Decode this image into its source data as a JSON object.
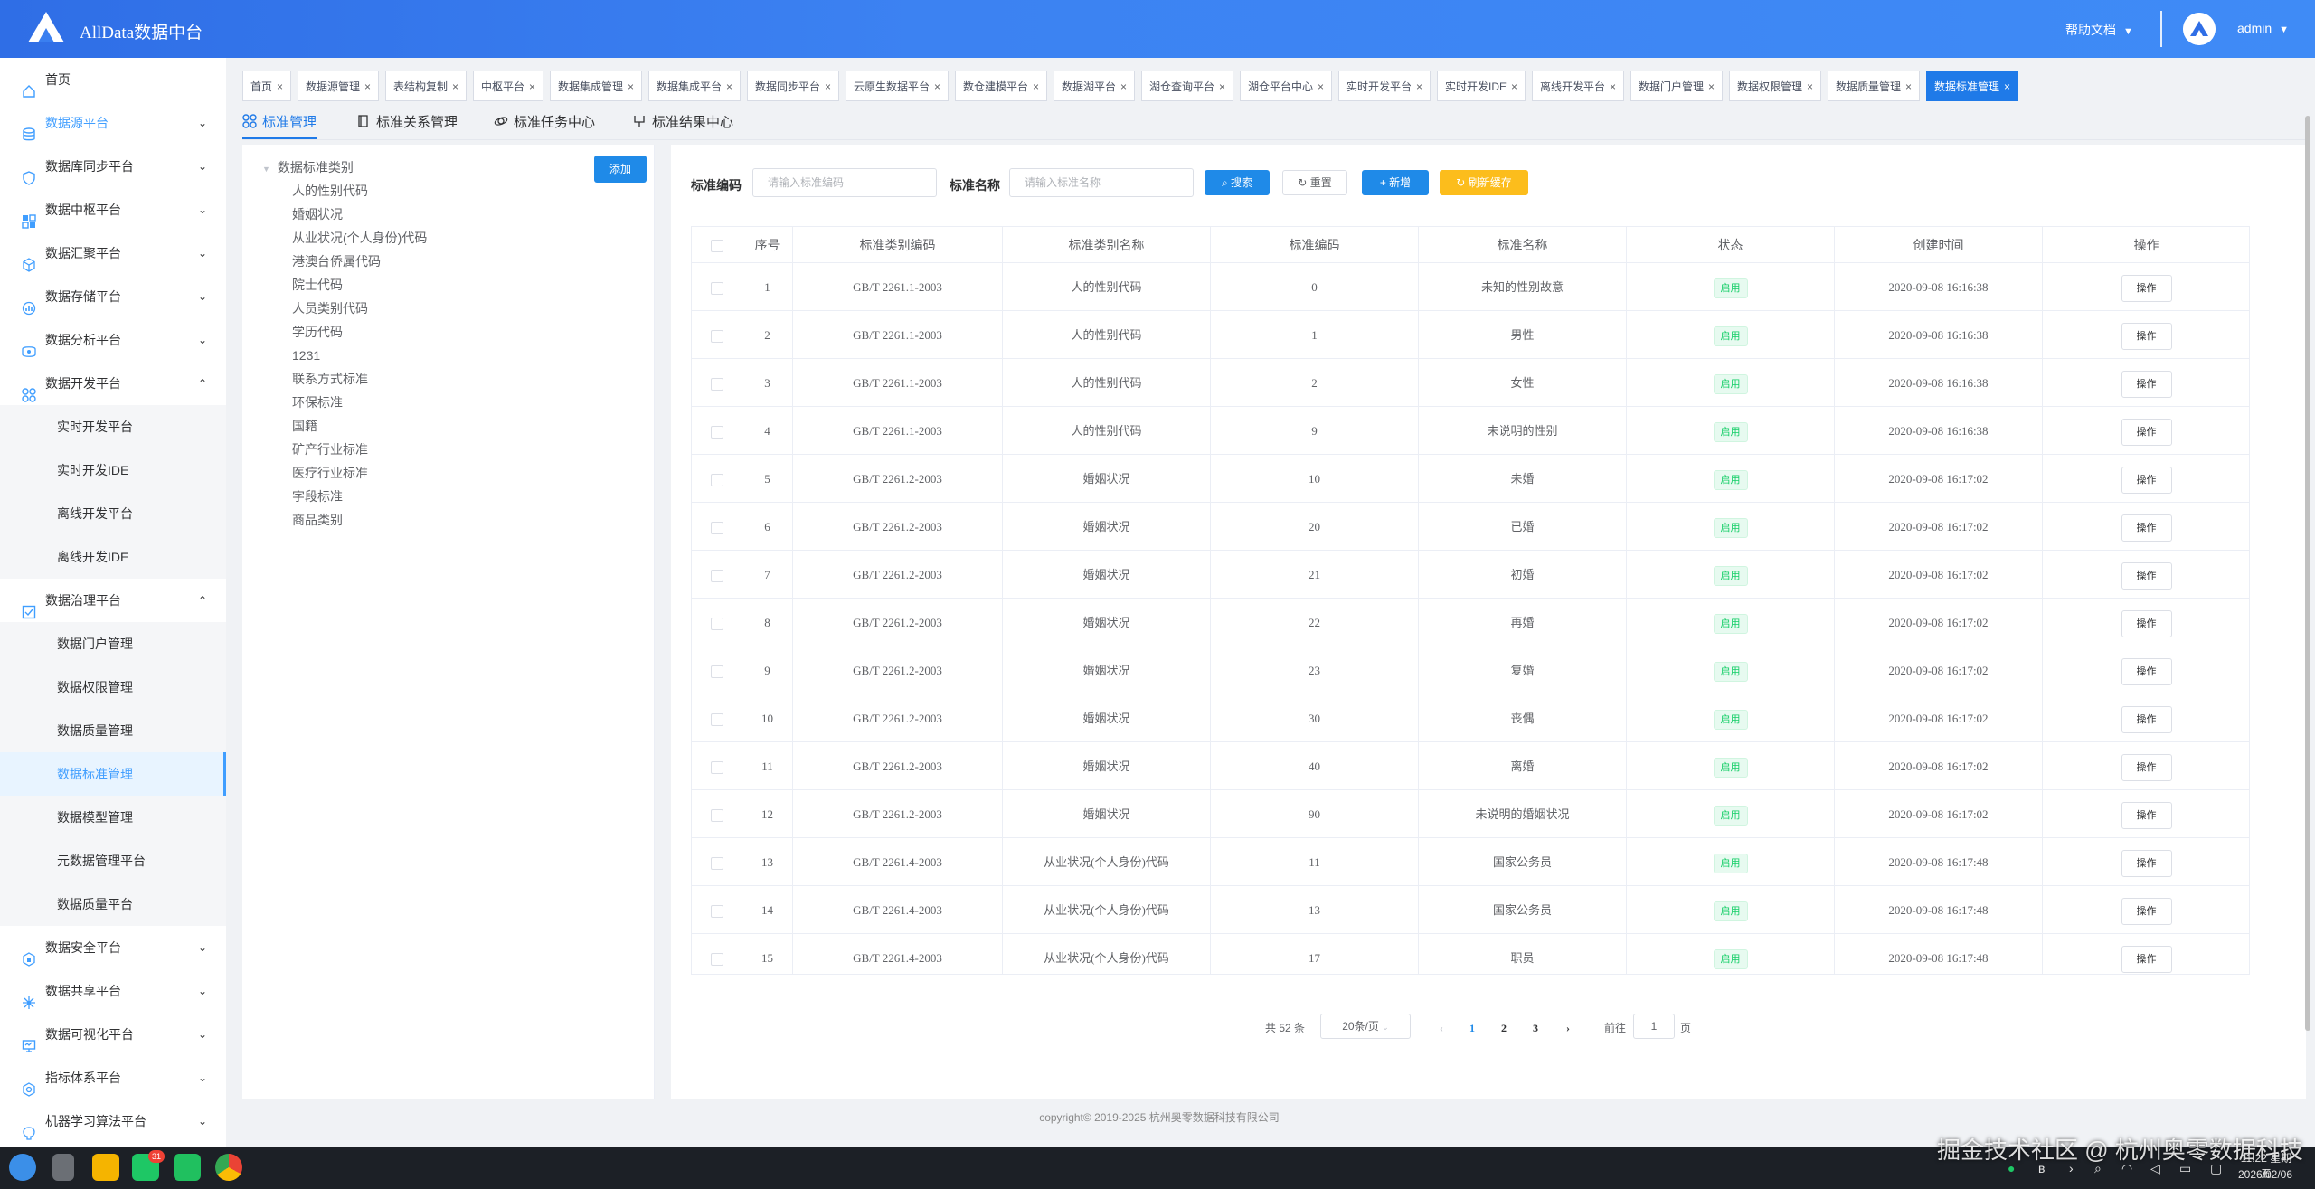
{
  "header": {
    "app_title": "AllData数据中台",
    "help_label": "帮助文档",
    "user_label": "admin"
  },
  "sidebar": {
    "items": [
      {
        "label": "首页",
        "icon": "home-icon"
      },
      {
        "label": "数据源平台",
        "icon": "database-icon",
        "highlight": true
      },
      {
        "label": "数据库同步平台",
        "icon": "shield-icon"
      },
      {
        "label": "数据中枢平台",
        "icon": "grid-icon"
      },
      {
        "label": "数据汇聚平台",
        "icon": "cube-icon"
      },
      {
        "label": "数据存储平台",
        "icon": "chart-icon"
      },
      {
        "label": "数据分析平台",
        "icon": "analysis-icon"
      },
      {
        "label": "数据开发平台",
        "icon": "apps-icon",
        "expanded": true
      }
    ],
    "dev_children": [
      "实时开发平台",
      "实时开发IDE",
      "离线开发平台",
      "离线开发IDE"
    ],
    "governance": {
      "label": "数据治理平台",
      "icon": "checklist-icon",
      "expanded": true
    },
    "governance_children": [
      "数据门户管理",
      "数据权限管理",
      "数据质量管理",
      "数据标准管理",
      "数据模型管理",
      "元数据管理平台",
      "数据质量平台"
    ],
    "active_child": "数据标准管理",
    "bottom_items": [
      {
        "label": "数据安全平台",
        "icon": "lock-icon"
      },
      {
        "label": "数据共享平台",
        "icon": "share-icon"
      },
      {
        "label": "数据可视化平台",
        "icon": "monitor-icon"
      },
      {
        "label": "指标体系平台",
        "icon": "target-icon"
      },
      {
        "label": "机器学习算法平台",
        "icon": "brain-icon"
      }
    ]
  },
  "tags": [
    "首页",
    "数据源管理",
    "表结构复制",
    "中枢平台",
    "数据集成管理",
    "数据集成平台",
    "数据同步平台",
    "云原生数据平台",
    "数仓建模平台",
    "数据湖平台",
    "湖仓查询平台",
    "湖仓平台中心",
    "实时开发平台",
    "实时开发IDE",
    "离线开发平台",
    "数据门户管理",
    "数据权限管理",
    "数据质量管理",
    "数据标准管理"
  ],
  "active_tag": "数据标准管理",
  "subtabs": [
    "标准管理",
    "标准关系管理",
    "标准任务中心",
    "标准结果中心"
  ],
  "tree": {
    "add_label": "添加",
    "root": "数据标准类别",
    "nodes": [
      "人的性别代码",
      "婚姻状况",
      "从业状况(个人身份)代码",
      "港澳台侨属代码",
      "院士代码",
      "人员类别代码",
      "学历代码",
      "1231",
      "联系方式标准",
      "环保标准",
      "国籍",
      "矿产行业标准",
      "医疗行业标准",
      "字段标准",
      "商品类别"
    ]
  },
  "filters": {
    "code_label": "标准编码",
    "code_placeholder": "请输入标准编码",
    "name_label": "标准名称",
    "name_placeholder": "请输入标准名称",
    "search_label": "搜索",
    "reset_label": "重置",
    "add_label": "新增",
    "refresh_label": "刷新缓存"
  },
  "table": {
    "columns": [
      "序号",
      "标准类别编码",
      "标准类别名称",
      "标准编码",
      "标准名称",
      "状态",
      "创建时间",
      "操作"
    ],
    "rows": [
      [
        "1",
        "GB/T 2261.1-2003",
        "人的性别代码",
        "0",
        "未知的性别故意",
        "启用",
        "2020-09-08 16:16:38",
        "操作"
      ],
      [
        "2",
        "GB/T 2261.1-2003",
        "人的性别代码",
        "1",
        "男性",
        "启用",
        "2020-09-08 16:16:38",
        "操作"
      ],
      [
        "3",
        "GB/T 2261.1-2003",
        "人的性别代码",
        "2",
        "女性",
        "启用",
        "2020-09-08 16:16:38",
        "操作"
      ],
      [
        "4",
        "GB/T 2261.1-2003",
        "人的性别代码",
        "9",
        "未说明的性别",
        "启用",
        "2020-09-08 16:16:38",
        "操作"
      ],
      [
        "5",
        "GB/T 2261.2-2003",
        "婚姻状况",
        "10",
        "未婚",
        "启用",
        "2020-09-08 16:17:02",
        "操作"
      ],
      [
        "6",
        "GB/T 2261.2-2003",
        "婚姻状况",
        "20",
        "已婚",
        "启用",
        "2020-09-08 16:17:02",
        "操作"
      ],
      [
        "7",
        "GB/T 2261.2-2003",
        "婚姻状况",
        "21",
        "初婚",
        "启用",
        "2020-09-08 16:17:02",
        "操作"
      ],
      [
        "8",
        "GB/T 2261.2-2003",
        "婚姻状况",
        "22",
        "再婚",
        "启用",
        "2020-09-08 16:17:02",
        "操作"
      ],
      [
        "9",
        "GB/T 2261.2-2003",
        "婚姻状况",
        "23",
        "复婚",
        "启用",
        "2020-09-08 16:17:02",
        "操作"
      ],
      [
        "10",
        "GB/T 2261.2-2003",
        "婚姻状况",
        "30",
        "丧偶",
        "启用",
        "2020-09-08 16:17:02",
        "操作"
      ],
      [
        "11",
        "GB/T 2261.2-2003",
        "婚姻状况",
        "40",
        "离婚",
        "启用",
        "2020-09-08 16:17:02",
        "操作"
      ],
      [
        "12",
        "GB/T 2261.2-2003",
        "婚姻状况",
        "90",
        "未说明的婚姻状况",
        "启用",
        "2020-09-08 16:17:02",
        "操作"
      ],
      [
        "13",
        "GB/T 2261.4-2003",
        "从业状况(个人身份)代码",
        "11",
        "国家公务员",
        "启用",
        "2020-09-08 16:17:48",
        "操作"
      ],
      [
        "14",
        "GB/T 2261.4-2003",
        "从业状况(个人身份)代码",
        "13",
        "国家公务员",
        "启用",
        "2020-09-08 16:17:48",
        "操作"
      ],
      [
        "15",
        "GB/T 2261.4-2003",
        "从业状况(个人身份)代码",
        "17",
        "职员",
        "启用",
        "2020-09-08 16:17:48",
        "操作"
      ]
    ]
  },
  "pagination": {
    "total": "共 52 条",
    "page_size": "20条/页",
    "pages": [
      "1",
      "2",
      "3"
    ],
    "current": "1",
    "goto_prefix": "前往",
    "goto_value": "1",
    "goto_suffix": "页"
  },
  "footer": "copyright© 2019-2025 杭州奥零数据科技有限公司",
  "watermark": "掘金技术社区 @ 杭州奥零数据科技",
  "taskbar": {
    "badge": "31",
    "time": "11:22 星期五",
    "date": "2026/02/06"
  },
  "colors": {
    "primary": "#1f8ae8",
    "header": "#3c82f2",
    "warning": "#fcbd1c",
    "success": "#13ce66"
  }
}
